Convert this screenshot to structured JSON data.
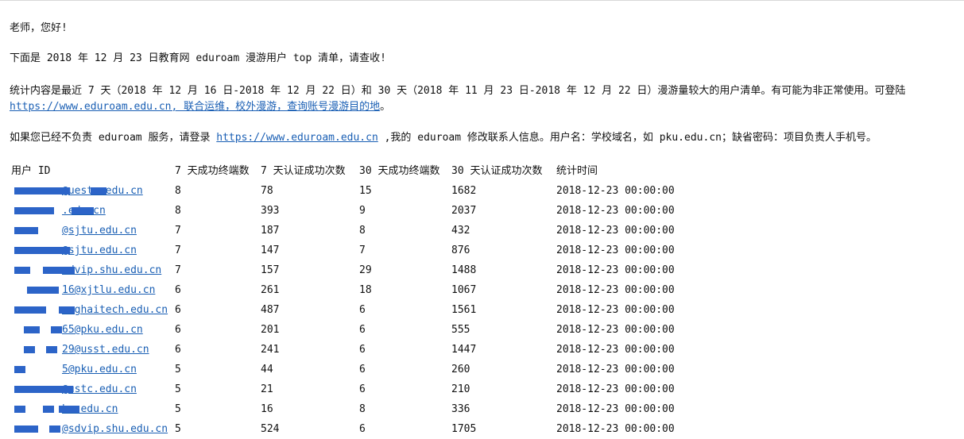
{
  "email": {
    "greeting": "老师，您好!",
    "intro": "下面是 2018 年 12 月 23 日教育网 eduroam 漫游用户 top 清单，请查收!",
    "stats_line": "统计内容是最近 7 天（2018 年 12 月 16 日-2018 年 12 月 22 日）和 30 天（2018 年 11 月 23 日-2018 年 12 月 22 日）漫游量较大的用户清单。有可能为非正常使用。可登陆",
    "stats_link": "https://www.eduroam.edu.cn, 联合运维，校外漫游，查询账号漫游目的地",
    "stats_end": "。",
    "contact_pre": "如果您已经不负责 eduroam 服务，请登录 ",
    "contact_link": "https://www.eduroam.edu.cn",
    "contact_post": " ,我的 eduroam 修改联系人信息。用户名：学校域名，如 pku.edu.cn；缺省密码：项目负责人手机号。"
  },
  "table": {
    "headers": [
      "用户 ID",
      "7 天成功终端数",
      "7 天认证成功次数",
      "30 天成功终端数",
      "30 天认证成功次数",
      "统计时间"
    ],
    "rows": [
      {
        "user_id": "@uestc.edu.cn",
        "d7_terminals": "8",
        "d7_auths": "78",
        "d30_terminals": "15",
        "d30_auths": "1682",
        "time": "2018-12-23 00:00:00"
      },
      {
        "user_id": ".edu.cn",
        "d7_terminals": "8",
        "d7_auths": "393",
        "d30_terminals": "9",
        "d30_auths": "2037",
        "time": "2018-12-23 00:00:00"
      },
      {
        "user_id": "@sjtu.edu.cn",
        "d7_terminals": "7",
        "d7_auths": "187",
        "d30_terminals": "8",
        "d30_auths": "432",
        "time": "2018-12-23 00:00:00"
      },
      {
        "user_id": "@sjtu.edu.cn",
        "d7_terminals": "7",
        "d7_auths": "147",
        "d30_terminals": "7",
        "d30_auths": "876",
        "time": "2018-12-23 00:00:00"
      },
      {
        "user_id": "sdvip.shu.edu.cn",
        "d7_terminals": "7",
        "d7_auths": "157",
        "d30_terminals": "29",
        "d30_auths": "1488",
        "time": "2018-12-23 00:00:00"
      },
      {
        "user_id": "16@xjtlu.edu.cn",
        "d7_terminals": "6",
        "d7_auths": "261",
        "d30_terminals": "18",
        "d30_auths": "1067",
        "time": "2018-12-23 00:00:00"
      },
      {
        "user_id": "anghaitech.edu.cn",
        "d7_terminals": "6",
        "d7_auths": "487",
        "d30_terminals": "6",
        "d30_auths": "1561",
        "time": "2018-12-23 00:00:00"
      },
      {
        "user_id": "65@pku.edu.cn",
        "d7_terminals": "6",
        "d7_auths": "201",
        "d30_terminals": "6",
        "d30_auths": "555",
        "time": "2018-12-23 00:00:00"
      },
      {
        "user_id": "29@usst.edu.cn",
        "d7_terminals": "6",
        "d7_auths": "241",
        "d30_terminals": "6",
        "d30_auths": "1447",
        "time": "2018-12-23 00:00:00"
      },
      {
        "user_id": "5@pku.edu.cn",
        "d7_terminals": "5",
        "d7_auths": "44",
        "d30_terminals": "6",
        "d30_auths": "260",
        "time": "2018-12-23 00:00:00"
      },
      {
        "user_id": "@ustc.edu.cn",
        "d7_terminals": "5",
        "d7_auths": "21",
        "d30_terminals": "6",
        "d30_auths": "210",
        "time": "2018-12-23 00:00:00"
      },
      {
        "user_id": "hu.edu.cn",
        "d7_terminals": "5",
        "d7_auths": "16",
        "d30_terminals": "8",
        "d30_auths": "336",
        "time": "2018-12-23 00:00:00"
      },
      {
        "user_id": "@sdvip.shu.edu.cn",
        "d7_terminals": "5",
        "d7_auths": "524",
        "d30_terminals": "6",
        "d30_auths": "1705",
        "time": "2018-12-23 00:00:00"
      }
    ]
  },
  "colors": {
    "link": "#1a5fb4",
    "redaction": "#2c64c8"
  }
}
